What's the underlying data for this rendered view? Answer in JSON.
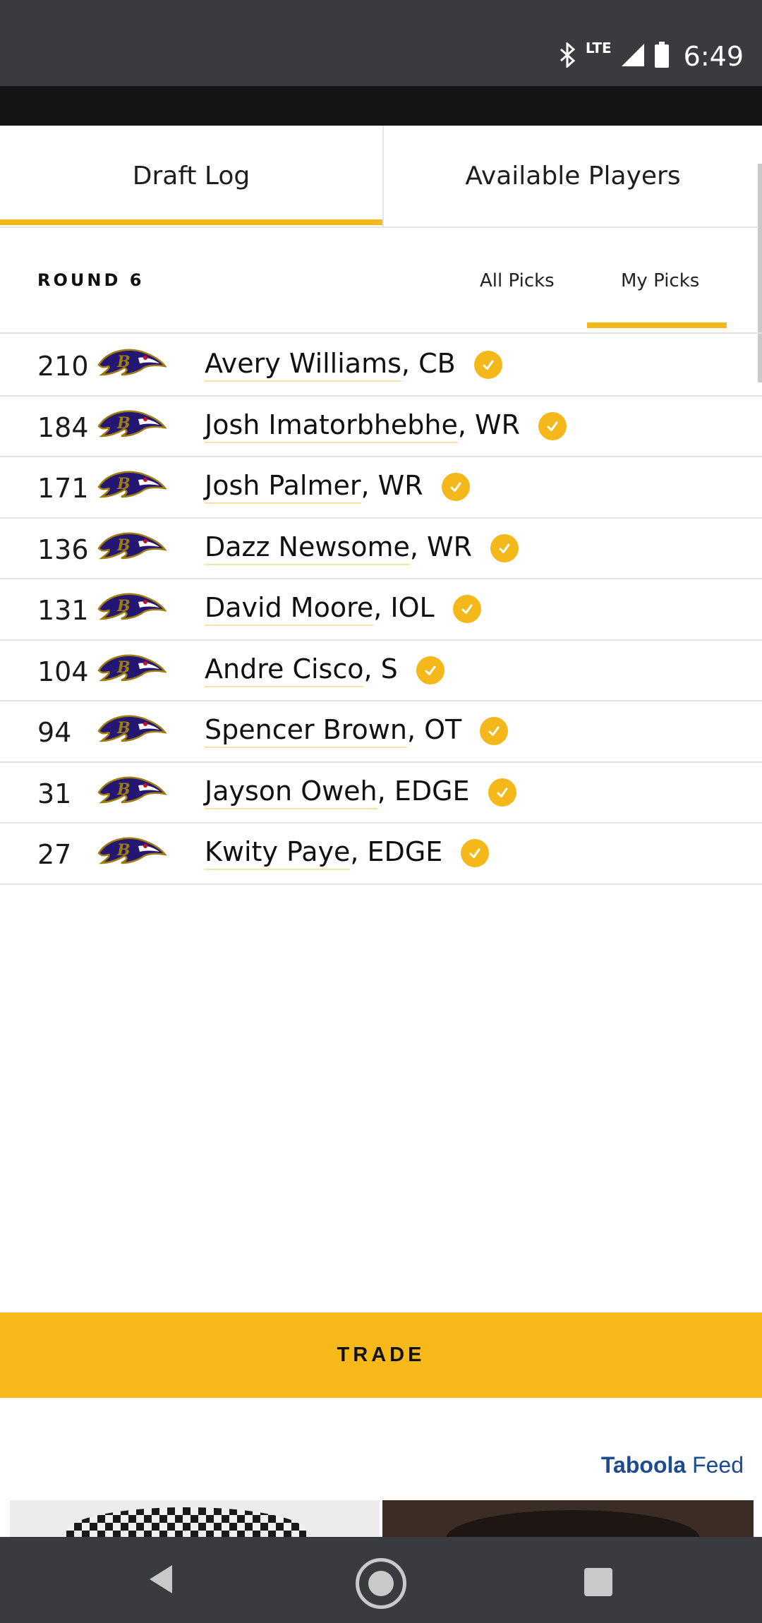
{
  "status_bar": {
    "network_label": "LTE",
    "time": "6:49",
    "icons": [
      "bluetooth-icon",
      "signal-icon",
      "battery-icon"
    ]
  },
  "tabs": {
    "draft_log": "Draft Log",
    "available_players": "Available Players",
    "active": "Draft Log"
  },
  "round_header": {
    "round_label": "ROUND 6",
    "filters": [
      "All Picks",
      "My Picks"
    ],
    "active_filter": "My Picks"
  },
  "picks": [
    {
      "pick": "210",
      "name": "Avery Williams",
      "pos": ", CB"
    },
    {
      "pick": "184",
      "name": "Josh Imatorbhebhe",
      "pos": ", WR"
    },
    {
      "pick": "171",
      "name": "Josh Palmer",
      "pos": ", WR"
    },
    {
      "pick": "136",
      "name": "Dazz Newsome",
      "pos": ", WR"
    },
    {
      "pick": "131",
      "name": "David Moore",
      "pos": ", IOL"
    },
    {
      "pick": "104",
      "name": "Andre Cisco",
      "pos": ", S"
    },
    {
      "pick": "94",
      "name": "Spencer Brown",
      "pos": ", OT"
    },
    {
      "pick": "31",
      "name": "Jayson Oweh",
      "pos": ", EDGE"
    },
    {
      "pick": "27",
      "name": "Kwity Paye",
      "pos": ", EDGE"
    }
  ],
  "trade_button": "TRADE",
  "taboola": {
    "brand": "Taboola",
    "feed": "Feed"
  },
  "colors": {
    "accent": "#f5b81b",
    "status_bar": "#3a3b3e",
    "logo_purple": "#241773",
    "logo_gold": "#9e7c0c"
  }
}
